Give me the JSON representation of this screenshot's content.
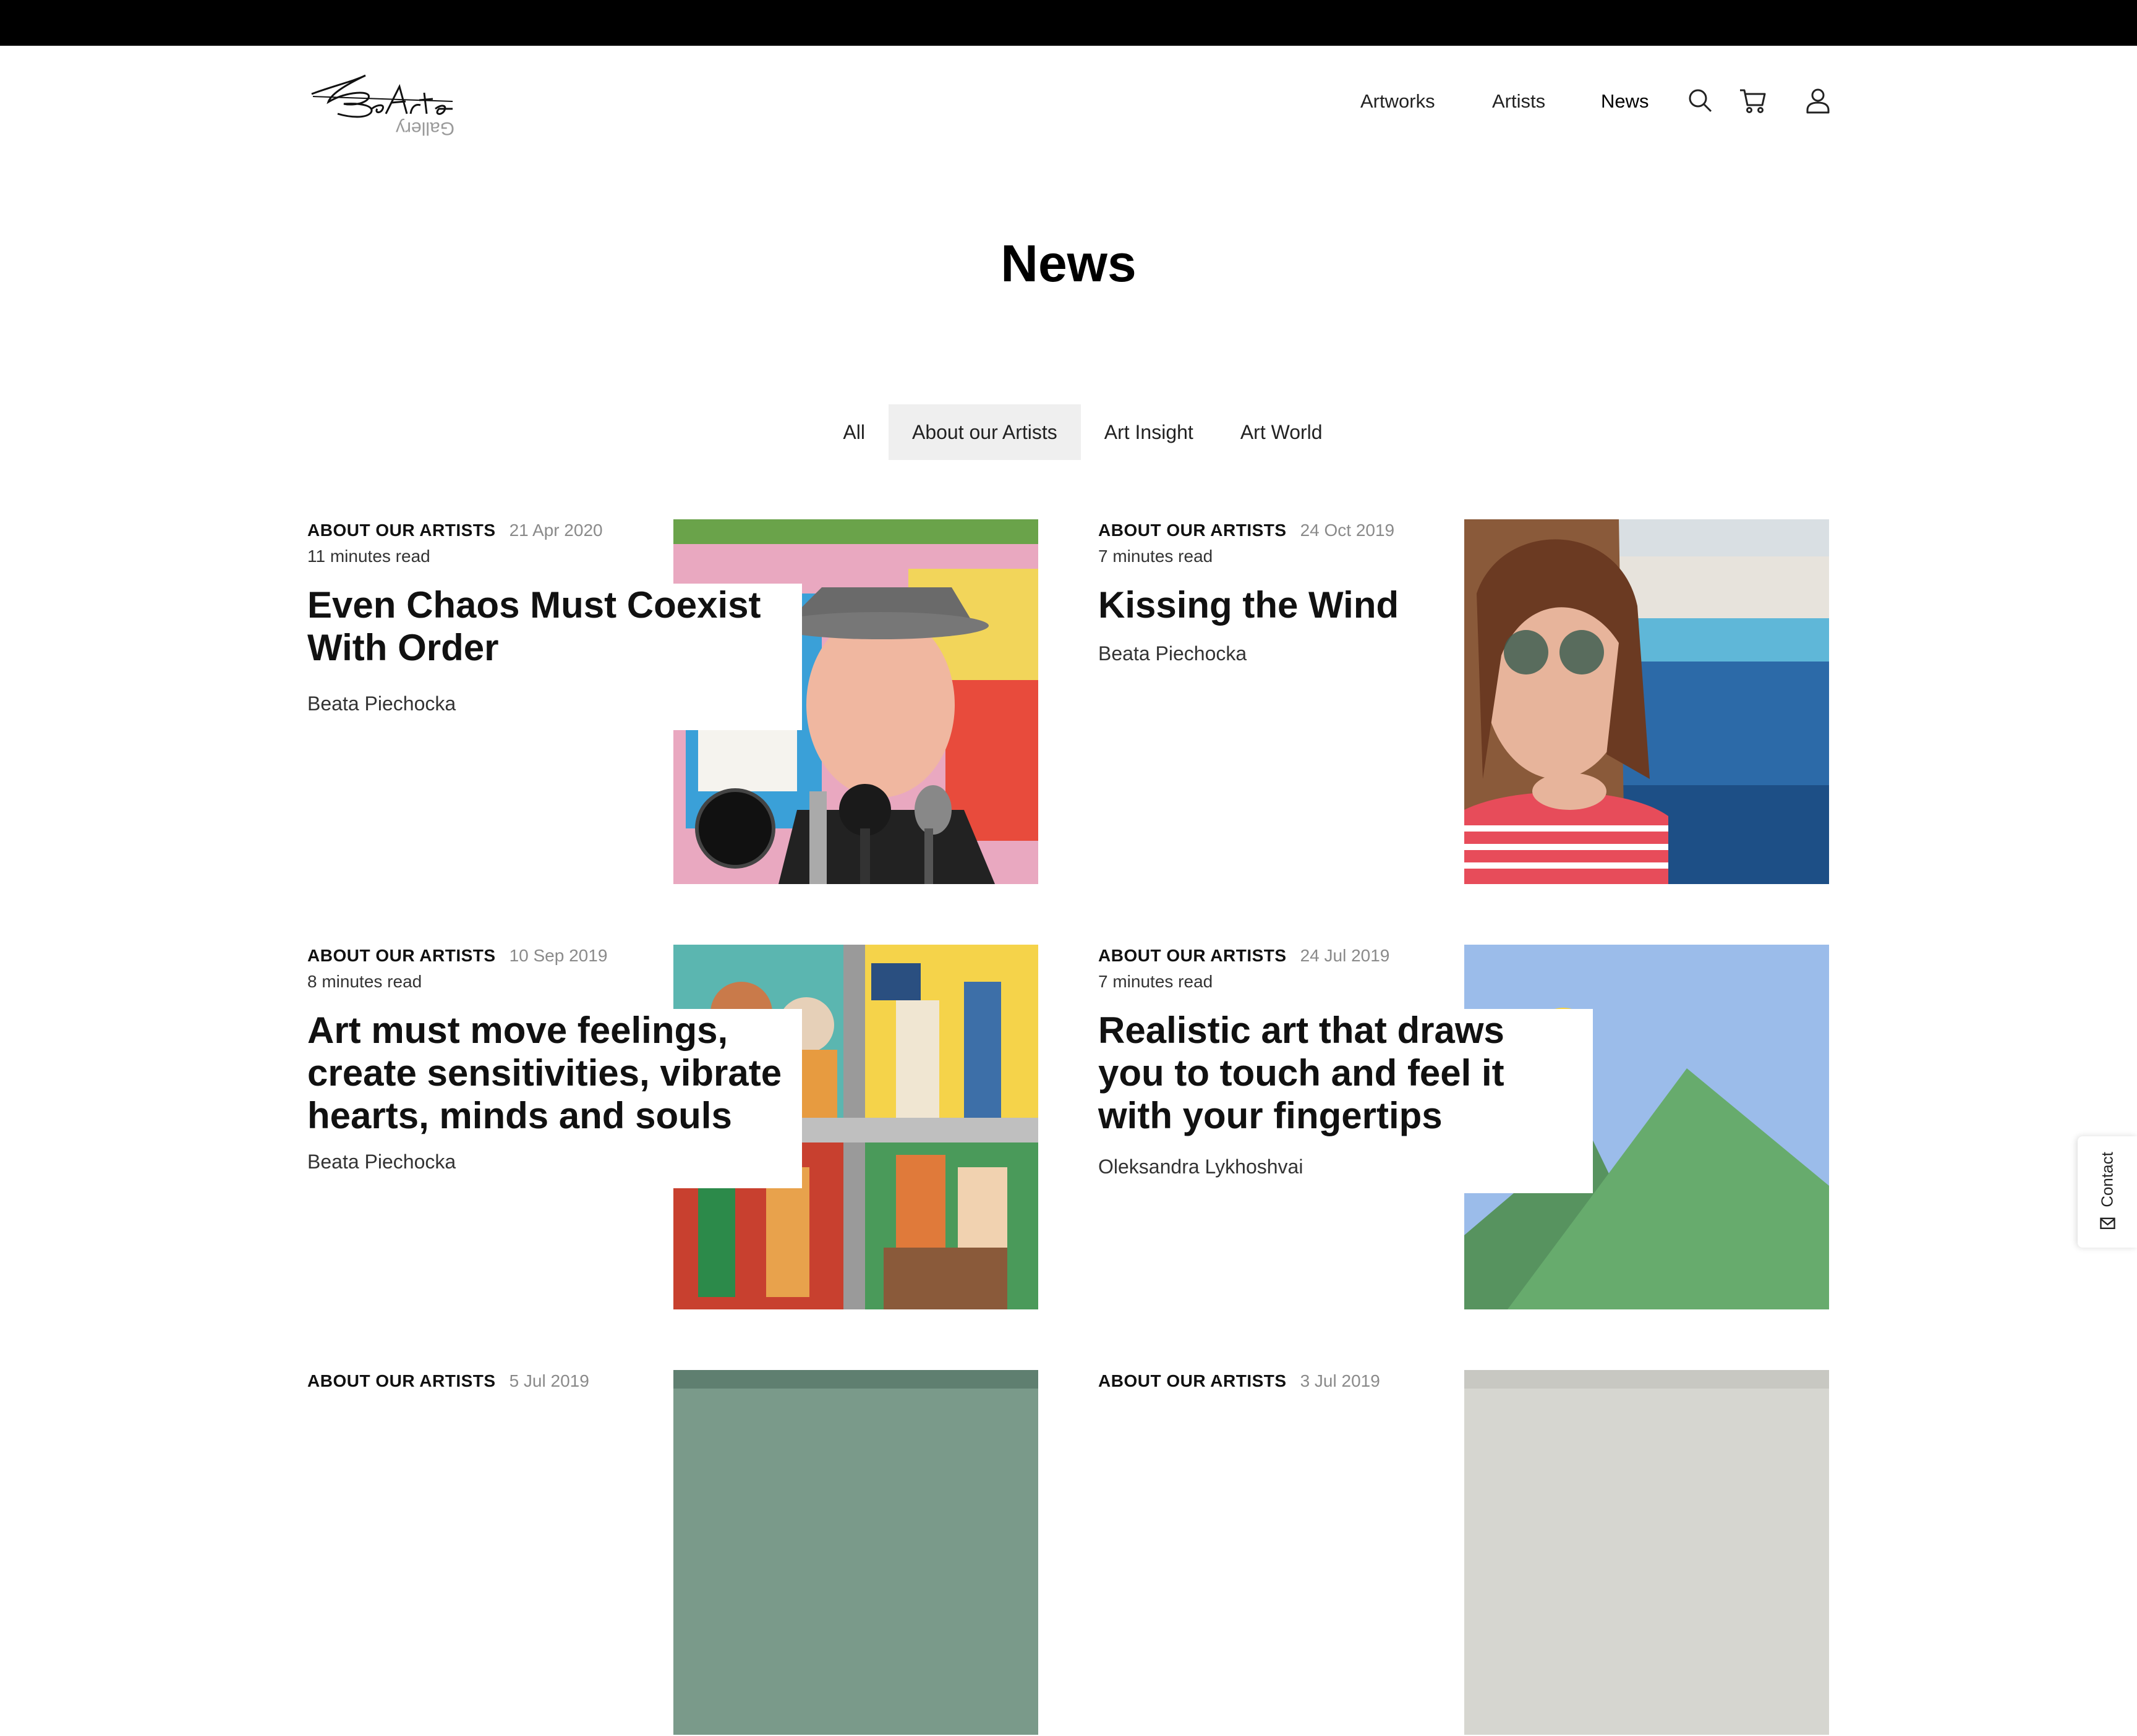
{
  "header": {
    "logo_text": "BeArte",
    "logo_sub": "Gallery",
    "nav": [
      "Artworks",
      "Artists",
      "News"
    ],
    "icons": [
      "search-icon",
      "cart-icon",
      "user-icon"
    ]
  },
  "page": {
    "title": "News"
  },
  "filters": {
    "tabs": [
      "All",
      "About our Artists",
      "Art Insight",
      "Art World"
    ],
    "active": "About our Artists"
  },
  "articles": [
    {
      "category": "ABOUT OUR ARTISTS",
      "date": "21 Apr 2020",
      "read_time": "11 minutes read",
      "title": "Even Chaos Must Coexist With Order",
      "author": "Beata Piechocka"
    },
    {
      "category": "ABOUT OUR ARTISTS",
      "date": "24 Oct 2019",
      "read_time": "7 minutes read",
      "title": "Kissing the Wind",
      "author": "Beata Piechocka"
    },
    {
      "category": "ABOUT OUR ARTISTS",
      "date": "10 Sep 2019",
      "read_time": "8 minutes read",
      "title": "Art must move feelings, create sensitivities, vibrate hearts, minds and souls",
      "author": "Beata Piechocka"
    },
    {
      "category": "ABOUT OUR ARTISTS",
      "date": "24 Jul 2019",
      "read_time": "7 minutes read",
      "title": "Realistic art that draws you to touch and feel it with your fingertips",
      "author": "Oleksandra Lykhoshvai"
    },
    {
      "category": "ABOUT OUR ARTISTS",
      "date": "5 Jul 2019",
      "read_time": "",
      "title": "",
      "author": ""
    },
    {
      "category": "ABOUT OUR ARTISTS",
      "date": "3 Jul 2019",
      "read_time": "",
      "title": "",
      "author": ""
    }
  ],
  "contact": {
    "label": "Contact"
  },
  "colors": {
    "accent": "#000000",
    "active_tab_bg": "#efefef",
    "muted": "#8a8a8a"
  }
}
